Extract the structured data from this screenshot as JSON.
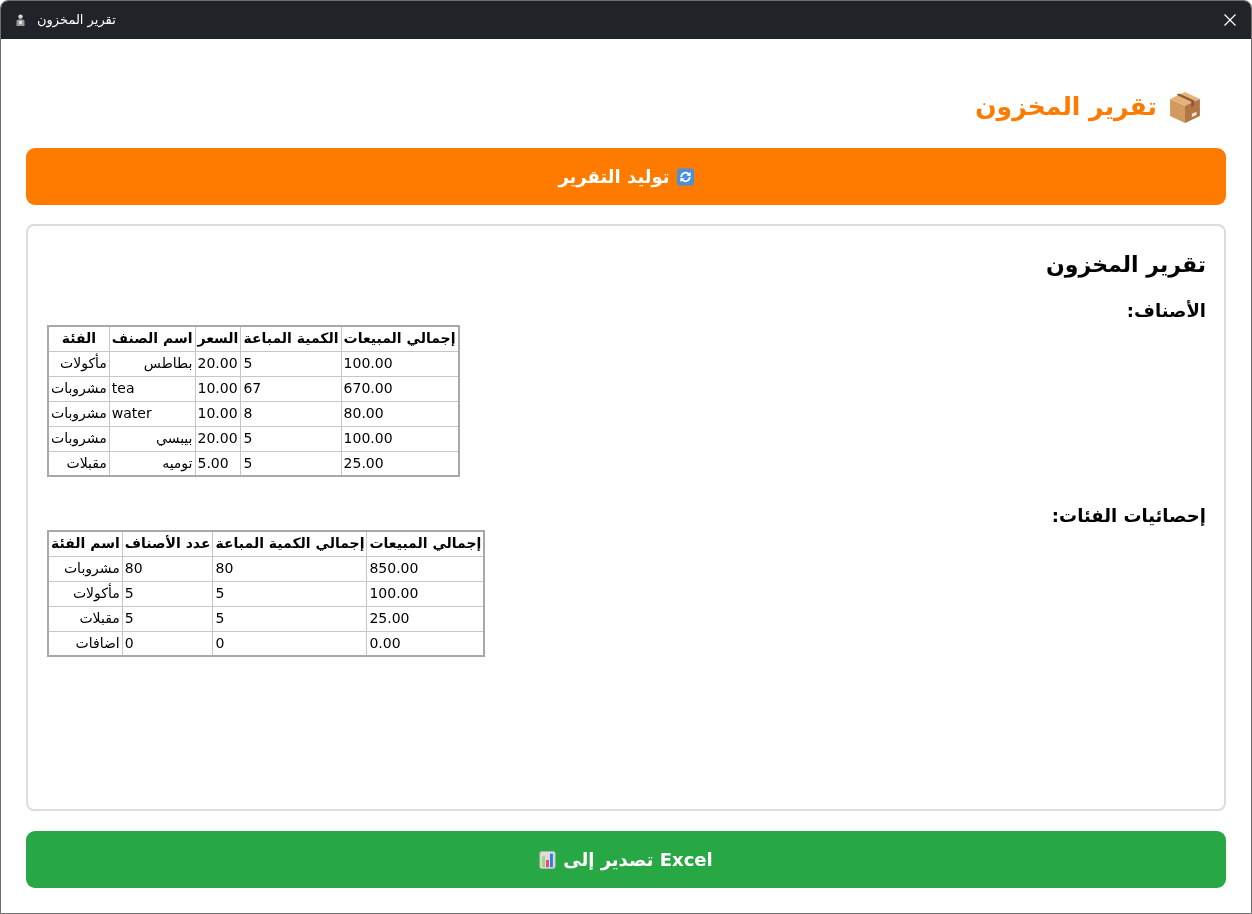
{
  "window": {
    "title": "تقرير المخزون"
  },
  "heading": {
    "title": "تقرير المخزون"
  },
  "generate_button": {
    "label": "توليد التقرير"
  },
  "report": {
    "title": "تقرير المخزون",
    "sections": [
      {
        "heading": "الأصناف:",
        "table": {
          "columns": [
            "إجمالي المبيعات",
            "الكمية المباعة",
            "السعر",
            "اسم الصنف",
            "الفئة"
          ],
          "rows": [
            [
              "100.00",
              "5",
              "20.00",
              "بطاطس",
              "مأكولات"
            ],
            [
              "670.00",
              "67",
              "10.00",
              "tea",
              "مشروبات"
            ],
            [
              "80.00",
              "8",
              "10.00",
              "water",
              "مشروبات"
            ],
            [
              "100.00",
              "5",
              "20.00",
              "بيبسي",
              "مشروبات"
            ],
            [
              "25.00",
              "5",
              "5.00",
              "توميه",
              "مقبلات"
            ]
          ]
        }
      },
      {
        "heading": "إحصائيات الفئات:",
        "table": {
          "columns": [
            "إجمالي المبيعات",
            "إجمالي الكمية المباعة",
            "عدد الأصناف",
            "اسم الفئة"
          ],
          "rows": [
            [
              "850.00",
              "80",
              "80",
              "مشروبات"
            ],
            [
              "100.00",
              "5",
              "5",
              "مأكولات"
            ],
            [
              "25.00",
              "5",
              "5",
              "مقبلات"
            ],
            [
              "0.00",
              "0",
              "0",
              "اضافات"
            ]
          ]
        }
      }
    ]
  },
  "export_button": {
    "label": "تصدير إلى Excel"
  }
}
